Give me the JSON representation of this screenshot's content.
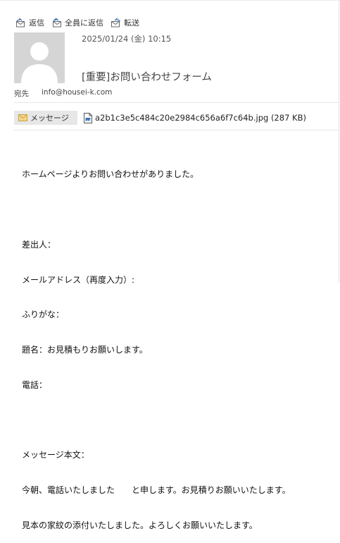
{
  "toolbar": {
    "reply": "返信",
    "reply_all": "全員に返信",
    "forward": "転送"
  },
  "header": {
    "date": "2025/01/24 (金) 10:15",
    "subject": "[重要]お問い合わせフォーム",
    "to_label": "宛先",
    "to_address": "info@housei-k.com"
  },
  "attachments": {
    "message_tab": "メッセージ",
    "file_name": "a2b1c3e5c484c20e2984c656a6f7c64b.jpg (287 KB)"
  },
  "body_lines": [
    "ホームページよりお問い合わせがありました。",
    "",
    "差出人：",
    "メールアドレス（再度入力）:",
    "ふりがな：",
    "題名：お見積もりお願いします。",
    "電話：",
    "",
    "メッセージ本文：",
    "今朝、電話いたしました　　と申します。お見積りお願いいたします。",
    "見本の家紋の添付いたしました。よろしくお願いいたします。"
  ],
  "colors": {
    "avatar_bg": "#d5d5d5",
    "avatar_fg": "#ffffff",
    "icon_blue": "#3d6fb3",
    "message_tab_bg": "#e7e7e7"
  }
}
